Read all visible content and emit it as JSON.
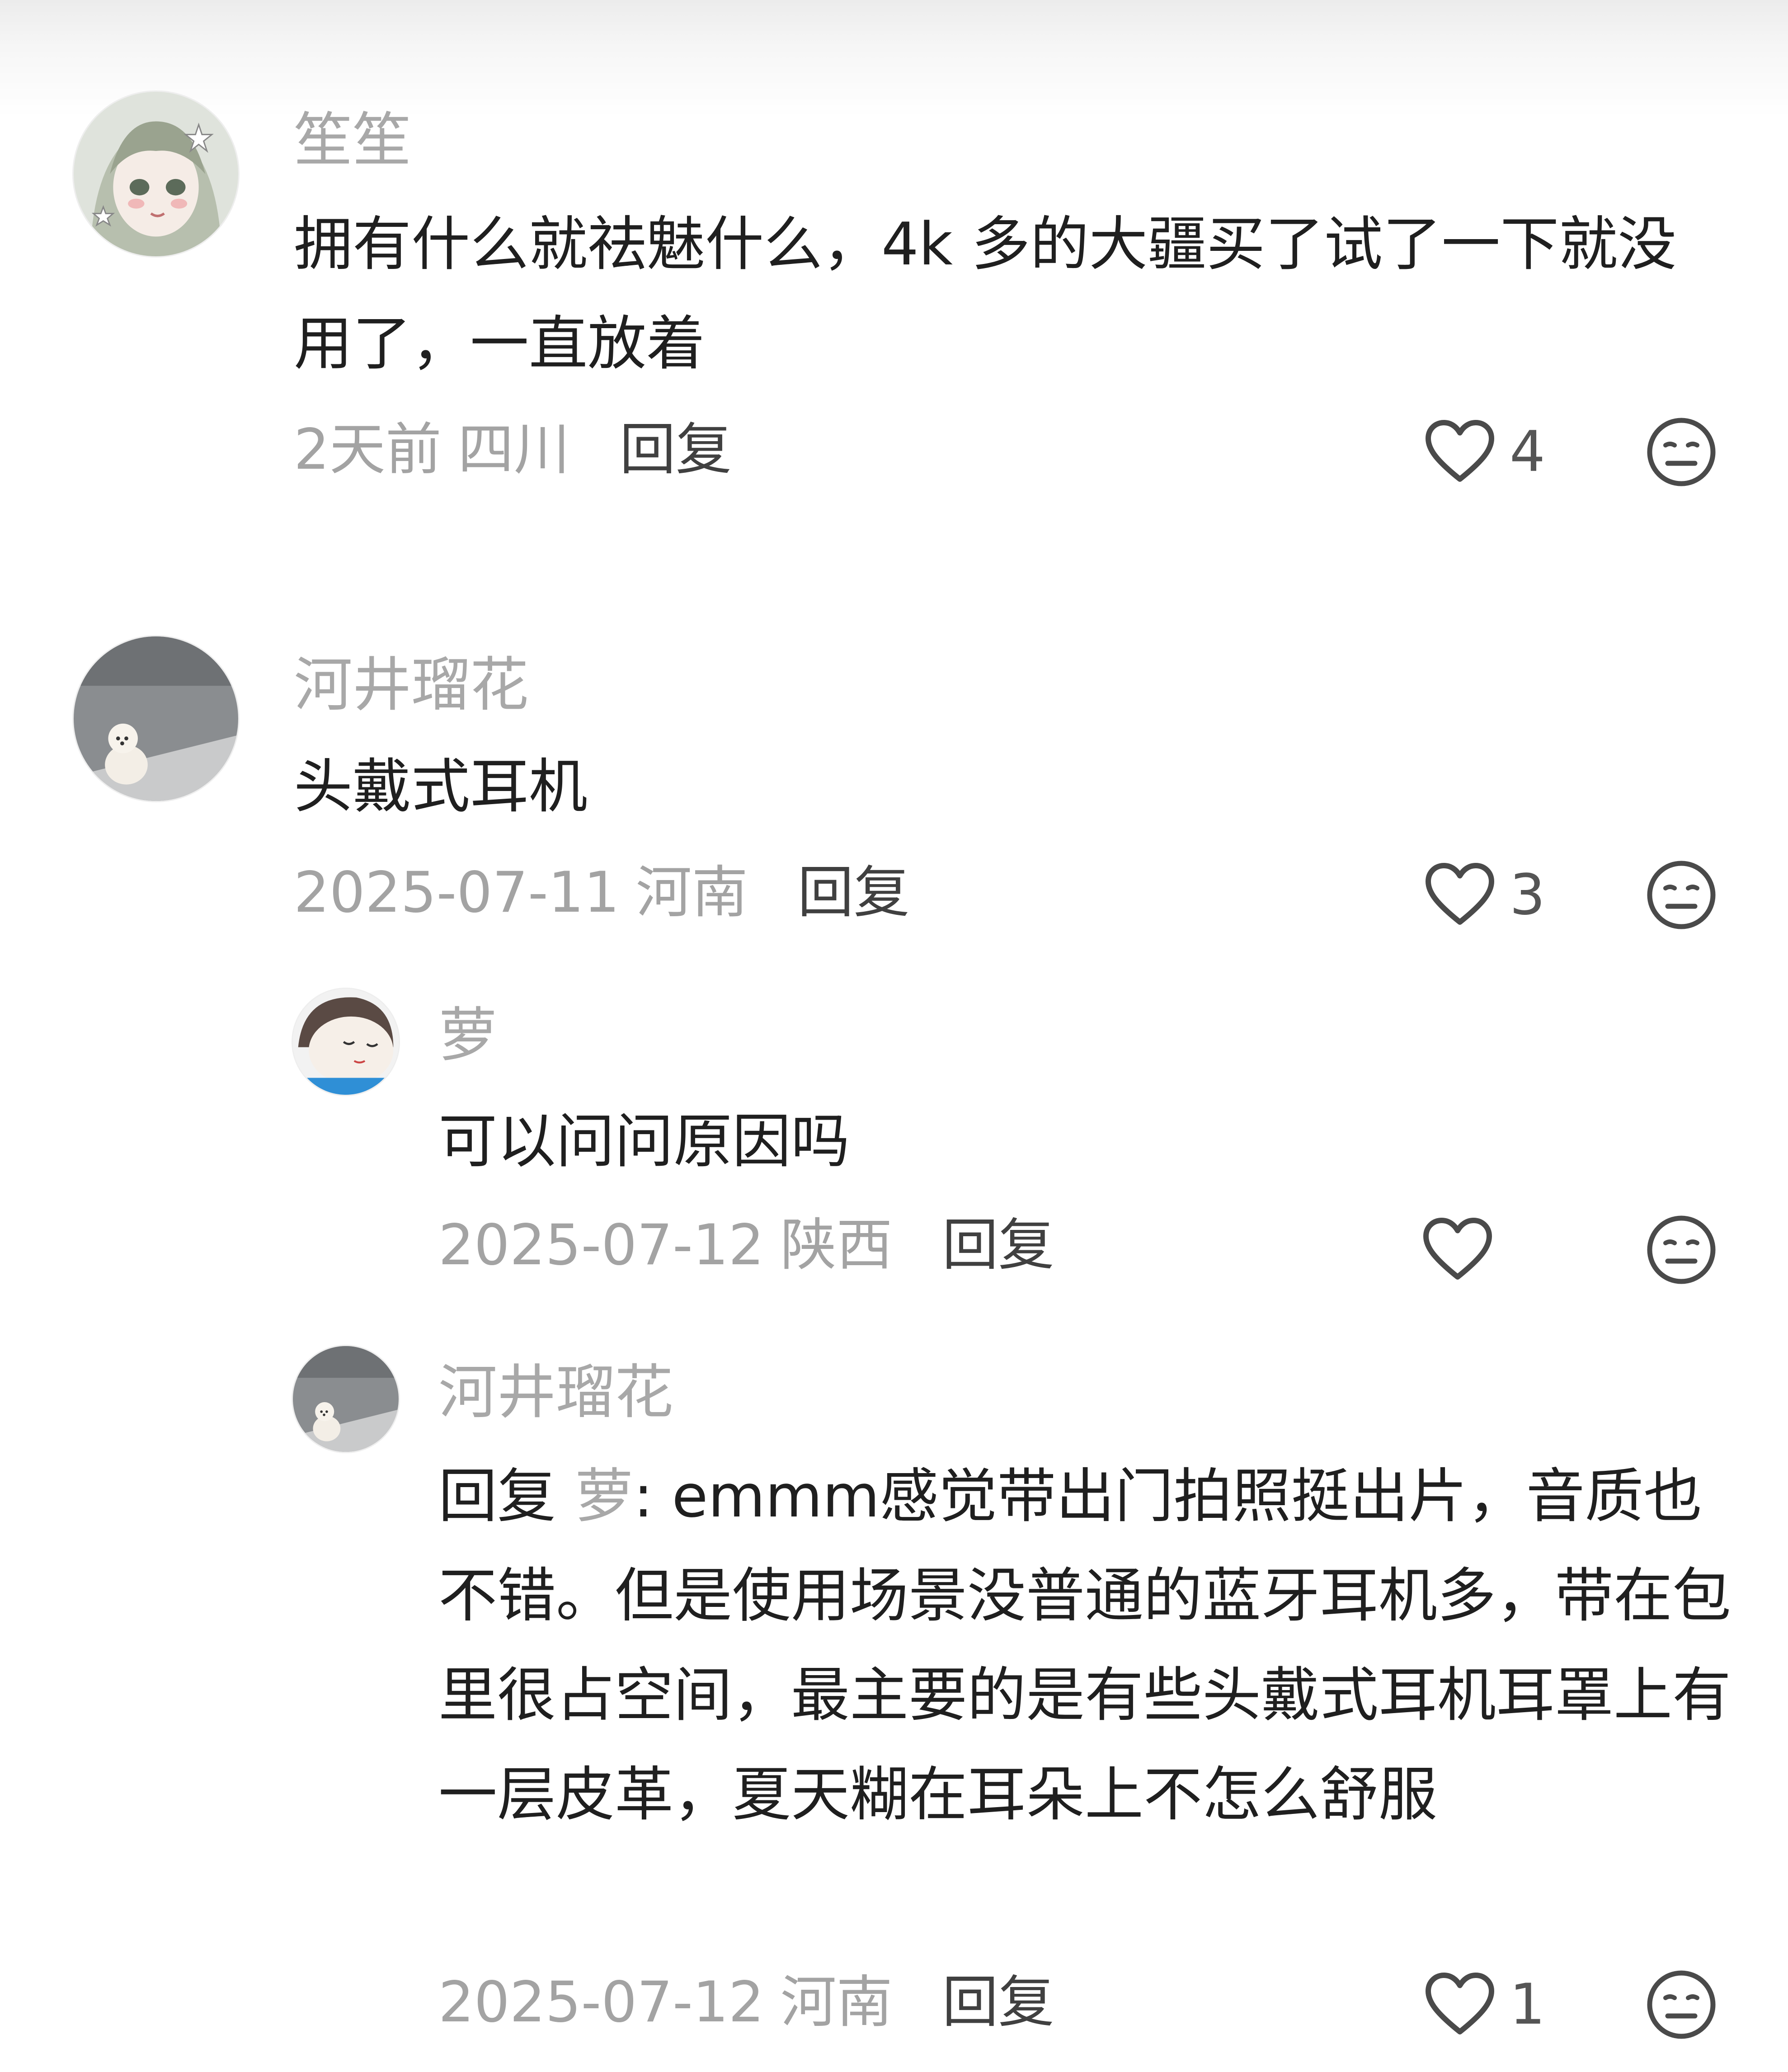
{
  "colors": {
    "username": "#a8a8a8",
    "text": "#1f1f1f",
    "meta": "#a3a3a3",
    "reply": "#404040",
    "icon": "#4a4a4a"
  },
  "comments": [
    {
      "username": "笙笙",
      "text": "拥有什么就祛魅什么，4k 多的大疆买了试了一下就没用了，一直放着",
      "time": "2天前",
      "location": "四川",
      "reply_label": "回复",
      "likes": "4",
      "avatar": "anime-girl"
    },
    {
      "username": "河井瑠花",
      "text": "头戴式耳机",
      "time": "2025-07-11",
      "location": "河南",
      "reply_label": "回复",
      "likes": "3",
      "avatar": "white-dog",
      "replies": [
        {
          "username": "萝",
          "text": "可以问问原因吗",
          "time": "2025-07-12",
          "location": "陕西",
          "reply_label": "回复",
          "likes": "",
          "avatar": "plush-doll"
        },
        {
          "username": "河井瑠花",
          "reply_prefix": "回复",
          "mention": "萝",
          "text": ": emmm感觉带出门拍照挺出片，音质也不错。但是使用场景没普通的蓝牙耳机多，带在包里很占空间，最主要的是有些头戴式耳机耳罩上有一层皮革，夏天糊在耳朵上不怎么舒服",
          "time": "2025-07-12",
          "location": "河南",
          "reply_label": "回复",
          "likes": "1",
          "avatar": "white-dog"
        }
      ]
    }
  ]
}
